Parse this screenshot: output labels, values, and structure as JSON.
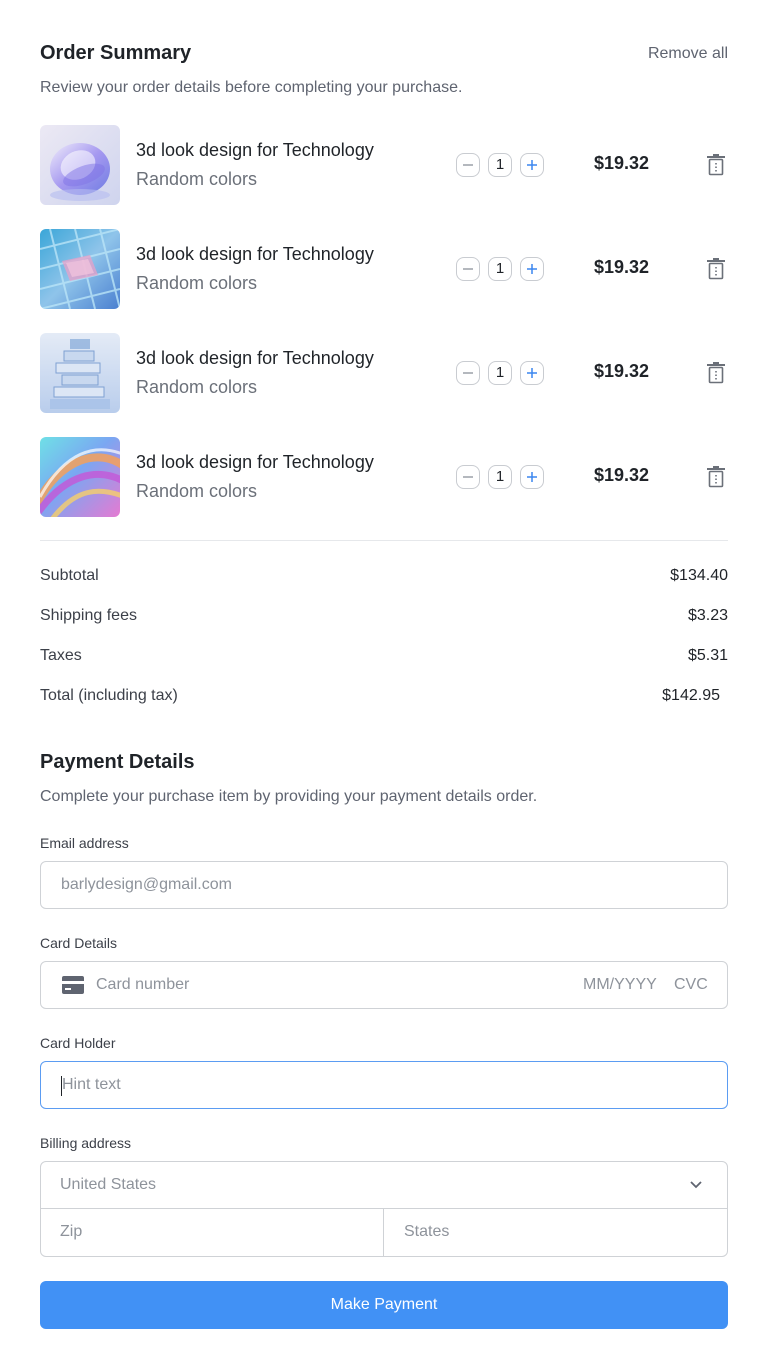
{
  "order_summary": {
    "title": "Order Summary",
    "remove_all_label": "Remove all",
    "subtitle": "Review your order details before completing your purchase.",
    "items": [
      {
        "name": "3d look design for Technology",
        "variant": "Random colors",
        "quantity": "1",
        "price": "$19.32"
      },
      {
        "name": "3d look design for Technology",
        "variant": "Random colors",
        "quantity": "1",
        "price": "$19.32"
      },
      {
        "name": "3d look design for Technology",
        "variant": "Random colors",
        "quantity": "1",
        "price": "$19.32"
      },
      {
        "name": "3d look design for Technology",
        "variant": "Random colors",
        "quantity": "1",
        "price": "$19.32"
      }
    ]
  },
  "totals": {
    "subtotal_label": "Subtotal",
    "subtotal_value": "$134.40",
    "shipping_label": "Shipping fees",
    "shipping_value": "$3.23",
    "taxes_label": "Taxes",
    "taxes_value": "$5.31",
    "total_label": "Total (including tax)",
    "total_value": "$142.95"
  },
  "payment": {
    "title": "Payment Details",
    "subtitle": "Complete your purchase item by providing your payment details order.",
    "email_label": "Email address",
    "email_placeholder": "barlydesign@gmail.com",
    "card_label": "Card Details",
    "card_number_placeholder": "Card number",
    "card_expiry_placeholder": "MM/YYYY",
    "card_cvc_placeholder": "CVC",
    "holder_label": "Card Holder",
    "holder_placeholder": "Hint text",
    "billing_label": "Billing address",
    "billing_country": "United States",
    "billing_zip_placeholder": "Zip",
    "billing_state_placeholder": "States",
    "submit_label": "Make Payment"
  },
  "colors": {
    "accent": "#4191f5",
    "focus_border": "#5b9cf2",
    "text_primary": "#1f2328",
    "text_muted": "#5f6470"
  },
  "icons": {
    "qty_decrease": "minus-circle-icon",
    "qty_increase": "plus-icon",
    "remove_item": "trash-icon",
    "card": "credit-card-icon",
    "dropdown": "chevron-down-icon"
  }
}
